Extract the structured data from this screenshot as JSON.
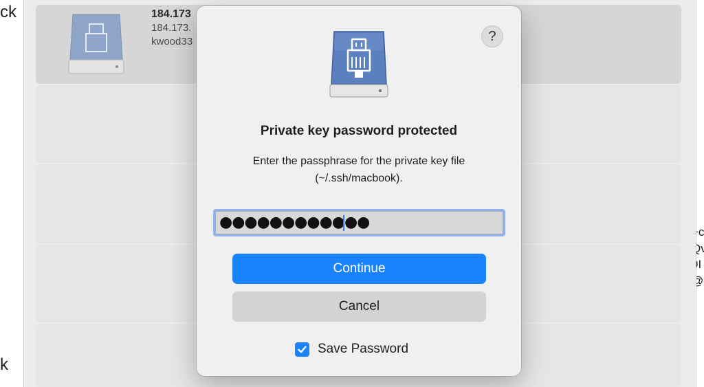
{
  "background": {
    "left_edge_top": "ck",
    "left_edge_bottom": "k",
    "right_edge_lines": [
      "+c",
      "Qv",
      "9I",
      "@l"
    ],
    "host": {
      "title": "184.173",
      "address": "184.173.",
      "user": "kwood33"
    }
  },
  "dialog": {
    "help_label": "?",
    "title": "Private key password protected",
    "message": "Enter the passphrase for the private key file (~/.ssh/macbook).",
    "password_value": "............",
    "continue_label": "Continue",
    "cancel_label": "Cancel",
    "save_password_label": "Save Password",
    "save_password_checked": true
  },
  "colors": {
    "accent": "#1a82fb",
    "focus_ring": "#8fb2ef",
    "icon_blue": "#5b7fbf"
  },
  "icons": [
    "server-drive-icon",
    "help-icon",
    "checkmark-icon"
  ]
}
